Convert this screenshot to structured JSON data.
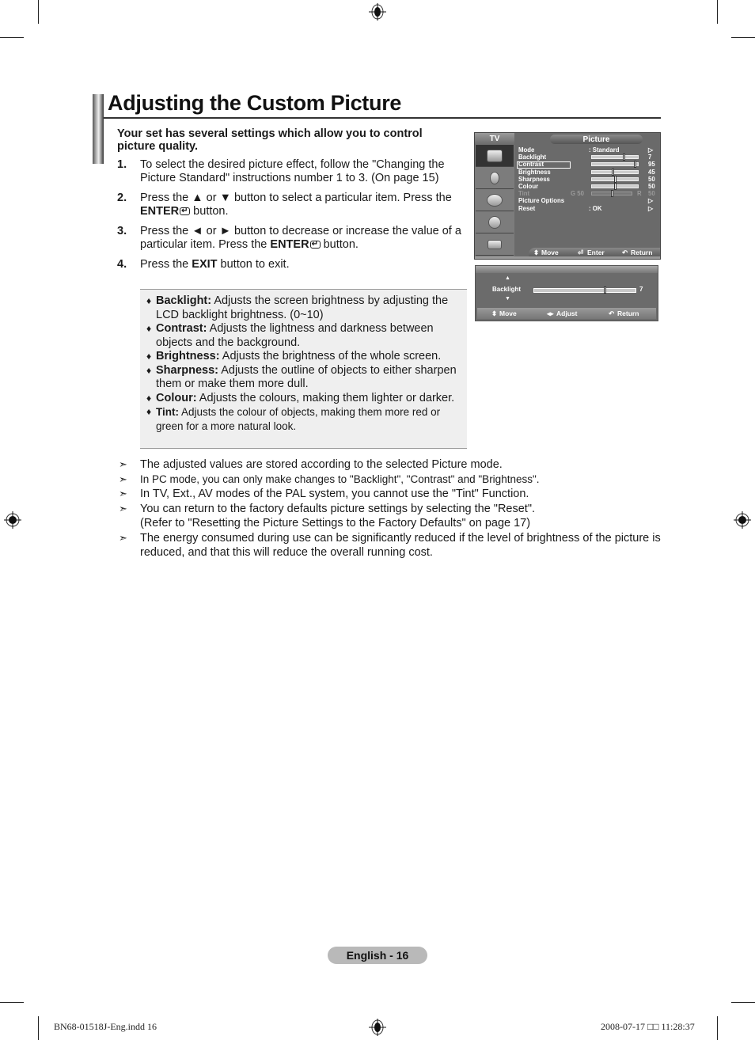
{
  "page": {
    "title": "Adjusting the Custom Picture",
    "intro": "Your set has several settings which allow you to control picture quality.",
    "steps": [
      {
        "num": "1.",
        "parts": [
          {
            "t": "To select the desired picture effect, follow the \"Changing the Picture Standard\" instructions number 1 to 3. (On page 15)"
          }
        ]
      },
      {
        "num": "2.",
        "text_a": "Press the ▲ or ▼ button to select a particular item. Press the ",
        "bold": "ENTER",
        "text_b": " button."
      },
      {
        "num": "3.",
        "text_a": "Press the ◄ or ► button to decrease or increase the value of a particular item. Press the ",
        "bold": "ENTER",
        "text_b": " button."
      },
      {
        "num": "4.",
        "text_a": "Press the ",
        "bold": "EXIT",
        "text_b": " button to exit."
      }
    ],
    "info_items": [
      {
        "term": "Backlight:",
        "desc": " Adjusts the screen brightness by adjusting the LCD backlight brightness. (0~10)"
      },
      {
        "term": "Contrast:",
        "desc": " Adjusts the lightness and darkness between objects and the background."
      },
      {
        "term": "Brightness:",
        "desc": " Adjusts the brightness of the whole screen."
      },
      {
        "term": "Sharpness:",
        "desc": " Adjusts the outline of objects to either sharpen them or make them more dull."
      },
      {
        "term": "Colour:",
        "desc": " Adjusts the colours, making them lighter or darker."
      },
      {
        "term": "Tint:",
        "desc": " Adjusts the colour of objects, making them more red or green for a more natural look."
      }
    ],
    "notes": [
      "The adjusted values are stored according to the selected Picture mode.",
      "In PC mode, you can only make changes to \"Backlight\", \"Contrast\" and \"Brightness\".",
      "In TV, Ext., AV modes of the PAL system, you cannot use the \"Tint\" Function.",
      "You can return to the factory defaults picture settings by selecting the \"Reset\". (Refer to \"Resetting the Picture Settings to the Factory Defaults\" on page 17)",
      "The energy consumed during use can be significantly reduced if the level of brightness of the picture is reduced, and that this will reduce the overall running cost."
    ],
    "page_number": "English - 16",
    "slug_left": "BN68-01518J-Eng.indd   16",
    "slug_right": "2008-07-17   □□ 11:28:37"
  },
  "osd_menu": {
    "source_label": "TV",
    "header": "Picture",
    "tabs": [
      "picture-icon",
      "sound-icon",
      "channel-icon",
      "setup-icon",
      "input-icon"
    ],
    "rows": [
      {
        "label": "Mode",
        "value": ":  Standard",
        "arrow": "▷"
      },
      {
        "label": "Backlight",
        "slider": 0.7,
        "num": "7"
      },
      {
        "label": "Contrast",
        "slider": 0.95,
        "num": "95",
        "selected": true
      },
      {
        "label": "Brightness",
        "slider": 0.45,
        "num": "45"
      },
      {
        "label": "Sharpness",
        "slider": 0.5,
        "num": "50"
      },
      {
        "label": "Colour",
        "slider": 0.5,
        "num": "50"
      },
      {
        "label": "Tint",
        "left": "G  50",
        "right": "R",
        "slider": 0.5,
        "num": "50",
        "disabled": true
      },
      {
        "label": "Picture Options",
        "arrow": "▷"
      },
      {
        "label": "Reset",
        "value": ": OK",
        "arrow": "▷"
      }
    ],
    "footer": {
      "move": "Move",
      "enter": "Enter",
      "return": "Return"
    }
  },
  "osd_adjust": {
    "label": "Backlight",
    "value": "7",
    "fraction": 0.7,
    "footer": {
      "move": "Move",
      "adjust": "Adjust",
      "return": "Return"
    }
  }
}
